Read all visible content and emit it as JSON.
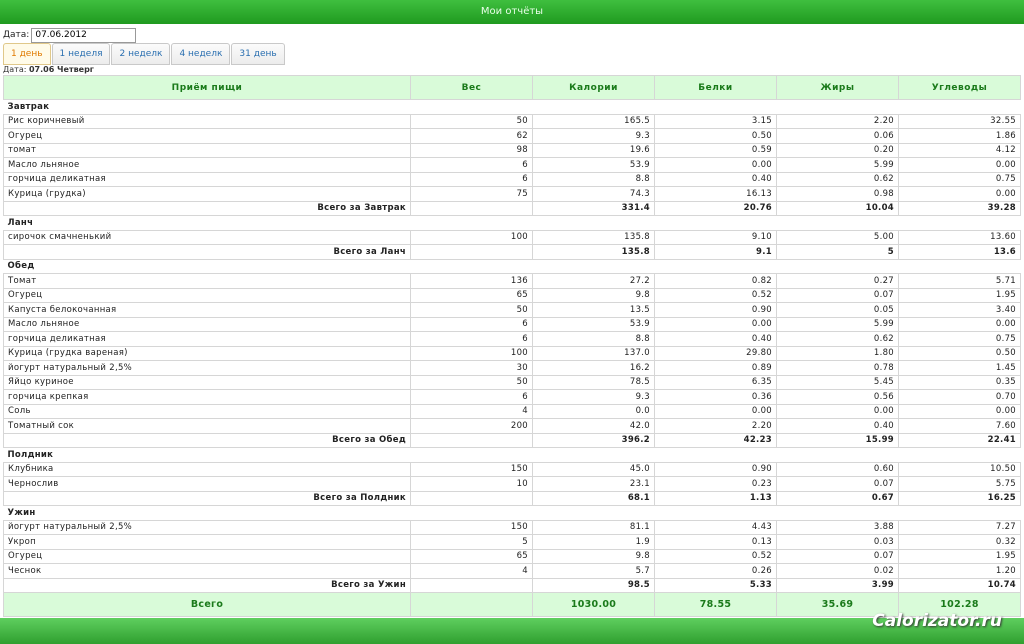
{
  "window": {
    "title": "Мои отчёты"
  },
  "date_label": "Дата:",
  "date_value": "07.06.2012",
  "tabs": [
    "1 день",
    "1 неделя",
    "2 неделк",
    "4 неделк",
    "31 день"
  ],
  "day_info": {
    "label": "Дата:",
    "value": "07.06 Четверг"
  },
  "columns": [
    "Приём пищи",
    "Вес",
    "Калории",
    "Белки",
    "Жиры",
    "Углеводы"
  ],
  "meals": [
    {
      "name": "Завтрак",
      "items": [
        [
          "Рис коричневый",
          "50",
          "165.5",
          "3.15",
          "2.20",
          "32.55"
        ],
        [
          "Огурец",
          "62",
          "9.3",
          "0.50",
          "0.06",
          "1.86"
        ],
        [
          "томат",
          "98",
          "19.6",
          "0.59",
          "0.20",
          "4.12"
        ],
        [
          "Масло льняное",
          "6",
          "53.9",
          "0.00",
          "5.99",
          "0.00"
        ],
        [
          "горчица деликатная",
          "6",
          "8.8",
          "0.40",
          "0.62",
          "0.75"
        ],
        [
          "Курица (грудка)",
          "75",
          "74.3",
          "16.13",
          "0.98",
          "0.00"
        ]
      ],
      "total": [
        "Всего за Завтрак",
        "",
        "331.4",
        "20.76",
        "10.04",
        "39.28"
      ]
    },
    {
      "name": "Ланч",
      "items": [
        [
          "сирочок смачненький",
          "100",
          "135.8",
          "9.10",
          "5.00",
          "13.60"
        ]
      ],
      "total": [
        "Всего за Ланч",
        "",
        "135.8",
        "9.1",
        "5",
        "13.6"
      ]
    },
    {
      "name": "Обед",
      "items": [
        [
          "Томат",
          "136",
          "27.2",
          "0.82",
          "0.27",
          "5.71"
        ],
        [
          "Огурец",
          "65",
          "9.8",
          "0.52",
          "0.07",
          "1.95"
        ],
        [
          "Капуста белокочанная",
          "50",
          "13.5",
          "0.90",
          "0.05",
          "3.40"
        ],
        [
          "Масло льняное",
          "6",
          "53.9",
          "0.00",
          "5.99",
          "0.00"
        ],
        [
          "горчица деликатная",
          "6",
          "8.8",
          "0.40",
          "0.62",
          "0.75"
        ],
        [
          "Курица (грудка вареная)",
          "100",
          "137.0",
          "29.80",
          "1.80",
          "0.50"
        ],
        [
          "йогурт натуральный 2,5%",
          "30",
          "16.2",
          "0.89",
          "0.78",
          "1.45"
        ],
        [
          "Яйцо куриное",
          "50",
          "78.5",
          "6.35",
          "5.45",
          "0.35"
        ],
        [
          "горчица крепкая",
          "6",
          "9.3",
          "0.36",
          "0.56",
          "0.70"
        ],
        [
          "Соль",
          "4",
          "0.0",
          "0.00",
          "0.00",
          "0.00"
        ],
        [
          "Томатный сок",
          "200",
          "42.0",
          "2.20",
          "0.40",
          "7.60"
        ]
      ],
      "total": [
        "Всего за Обед",
        "",
        "396.2",
        "42.23",
        "15.99",
        "22.41"
      ]
    },
    {
      "name": "Полдник",
      "items": [
        [
          "Клубника",
          "150",
          "45.0",
          "0.90",
          "0.60",
          "10.50"
        ],
        [
          "Чернослив",
          "10",
          "23.1",
          "0.23",
          "0.07",
          "5.75"
        ]
      ],
      "total": [
        "Всего за Полдник",
        "",
        "68.1",
        "1.13",
        "0.67",
        "16.25"
      ]
    },
    {
      "name": "Ужин",
      "items": [
        [
          "йогурт натуральный 2,5%",
          "150",
          "81.1",
          "4.43",
          "3.88",
          "7.27"
        ],
        [
          "Укроп",
          "5",
          "1.9",
          "0.13",
          "0.03",
          "0.32"
        ],
        [
          "Огурец",
          "65",
          "9.8",
          "0.52",
          "0.07",
          "1.95"
        ],
        [
          "Чеснок",
          "4",
          "5.7",
          "0.26",
          "0.02",
          "1.20"
        ]
      ],
      "total": [
        "Всего за Ужин",
        "",
        "98.5",
        "5.33",
        "3.99",
        "10.74"
      ]
    }
  ],
  "grand_total": [
    "Всего",
    "",
    "1030.00",
    "78.55",
    "35.69",
    "102.28"
  ],
  "watermark": "Calorizator.ru"
}
